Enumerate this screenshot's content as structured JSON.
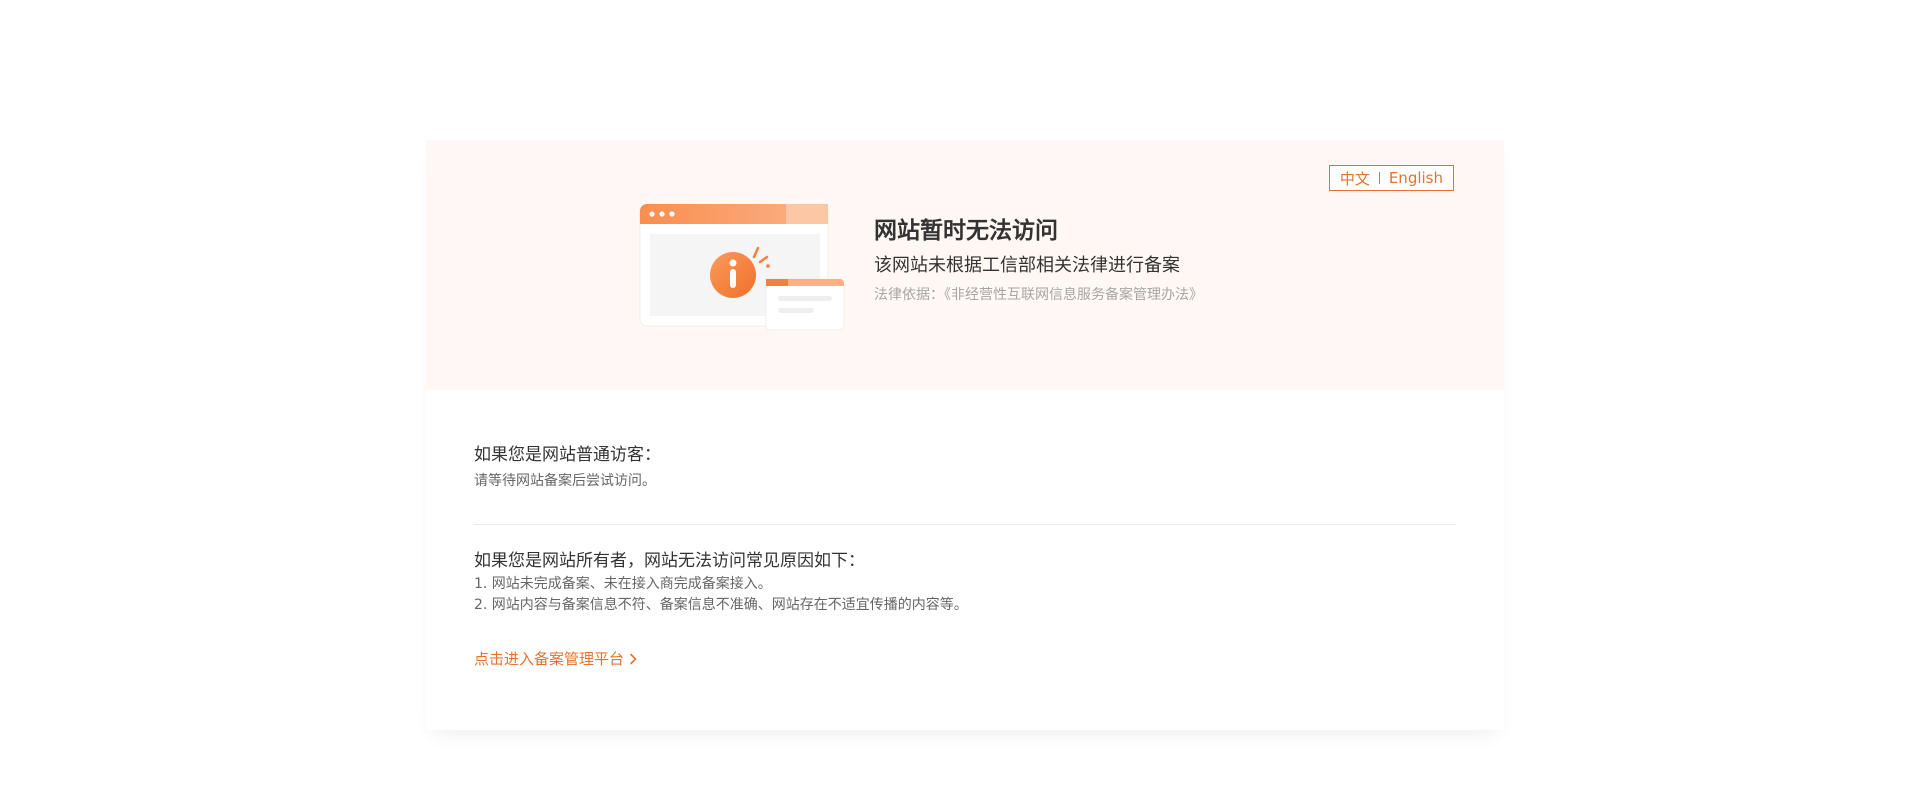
{
  "lang_switch": {
    "zh": "中文",
    "en": "English"
  },
  "banner": {
    "title": "网站暂时无法访问",
    "subtitle": "该网站未根据工信部相关法律进行备案",
    "law_basis": "法律依据：《非经营性互联网信息服务备案管理办法》"
  },
  "visitor": {
    "heading": "如果您是网站普通访客：",
    "line": "请等待网站备案后尝试访问。"
  },
  "owner": {
    "heading": "如果您是网站所有者，网站无法访问常见原因如下：",
    "reasons": [
      "1. 网站未完成备案、未在接入商完成备案接入。",
      "2. 网站内容与备案信息不符、备案信息不准确、网站存在不适宜传播的内容等。"
    ]
  },
  "link": {
    "label": "点击进入备案管理平台"
  },
  "colors": {
    "accent": "#e8722d",
    "banner_bg": "#fff8f5",
    "text_dark": "#333333",
    "text_muted": "#a6a6a6"
  },
  "icons": [
    "info-icon",
    "chevron-right-icon"
  ]
}
